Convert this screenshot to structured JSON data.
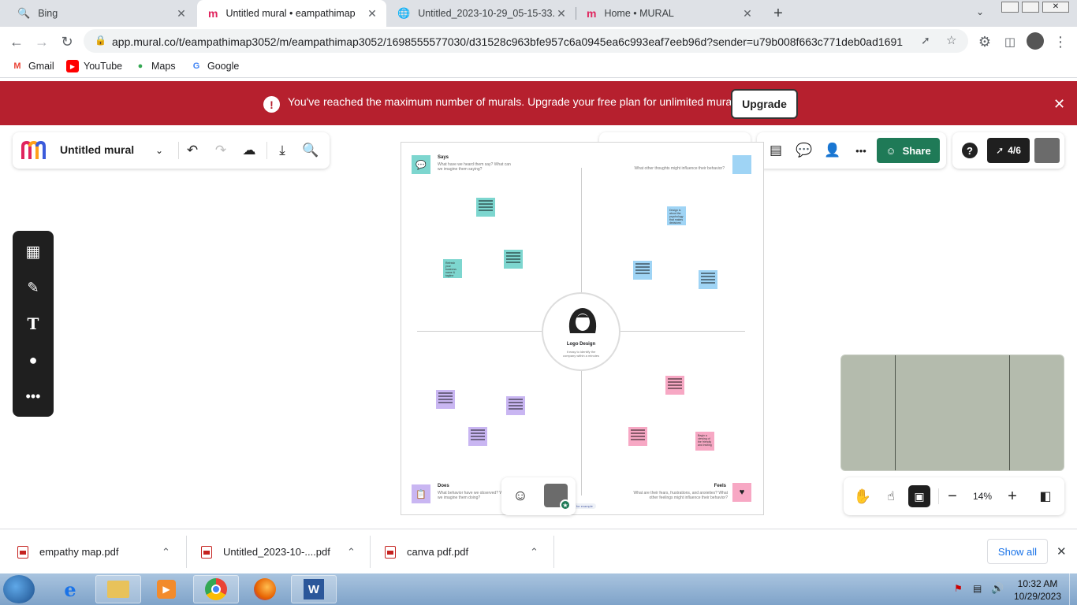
{
  "browser": {
    "tabs": [
      {
        "title": "Bing",
        "icon": "bing-search-icon",
        "active": false
      },
      {
        "title": "Untitled mural • eampathimap",
        "icon": "mural-logo-icon",
        "active": true
      },
      {
        "title": "Untitled_2023-10-29_05-15-33.p",
        "icon": "globe-icon",
        "active": false
      },
      {
        "title": "Home • MURAL",
        "icon": "mural-logo-icon",
        "active": false
      }
    ],
    "url": "app.mural.co/t/eampathimap3052/m/eampathimap3052/1698555577030/d31528c963bfe957c6a0945ea6c993eaf7eeb96d?sender=u79b008f663c771deb0ad1691",
    "bookmarks": [
      "Gmail",
      "YouTube",
      "Maps",
      "Google"
    ]
  },
  "banner": {
    "message": "You've reached the maximum number of murals. Upgrade your free plan for unlimited murals.",
    "button": "Upgrade",
    "color": "#b6202e"
  },
  "mural": {
    "title": "Untitled mural",
    "share_label": "Share",
    "counter": "4/6",
    "zoom": "14%",
    "brand_color": "#1f7a57"
  },
  "board": {
    "center_title": "Logo Design",
    "center_desc": "It easy to identify the company within a minutes",
    "says_title": "Says",
    "says_desc": "What have we heard them say? What can we imagine them saying?",
    "thinks_desc": "What other thoughts might influence their behavior?",
    "does_title": "Does",
    "does_desc": "What behavior have we observed? What can we imagine them doing?",
    "feels_title": "Feels",
    "feels_desc": "What are their fears, frustrations, and anxieties? What other feelings might influence their behavior?",
    "note_teal": "Refresh your business name & tagline",
    "note_blue": "Design is about the psychology that makes decisions",
    "note_pink": "Begin a viewing of the friendly and inviting",
    "cursor_label": "for example"
  },
  "downloads": [
    {
      "name": "empathy map.pdf"
    },
    {
      "name": "Untitled_2023-10-....pdf"
    },
    {
      "name": "canva pdf.pdf"
    }
  ],
  "downloads_show_all": "Show all",
  "clock": {
    "time": "10:32 AM",
    "date": "10/29/2023"
  }
}
